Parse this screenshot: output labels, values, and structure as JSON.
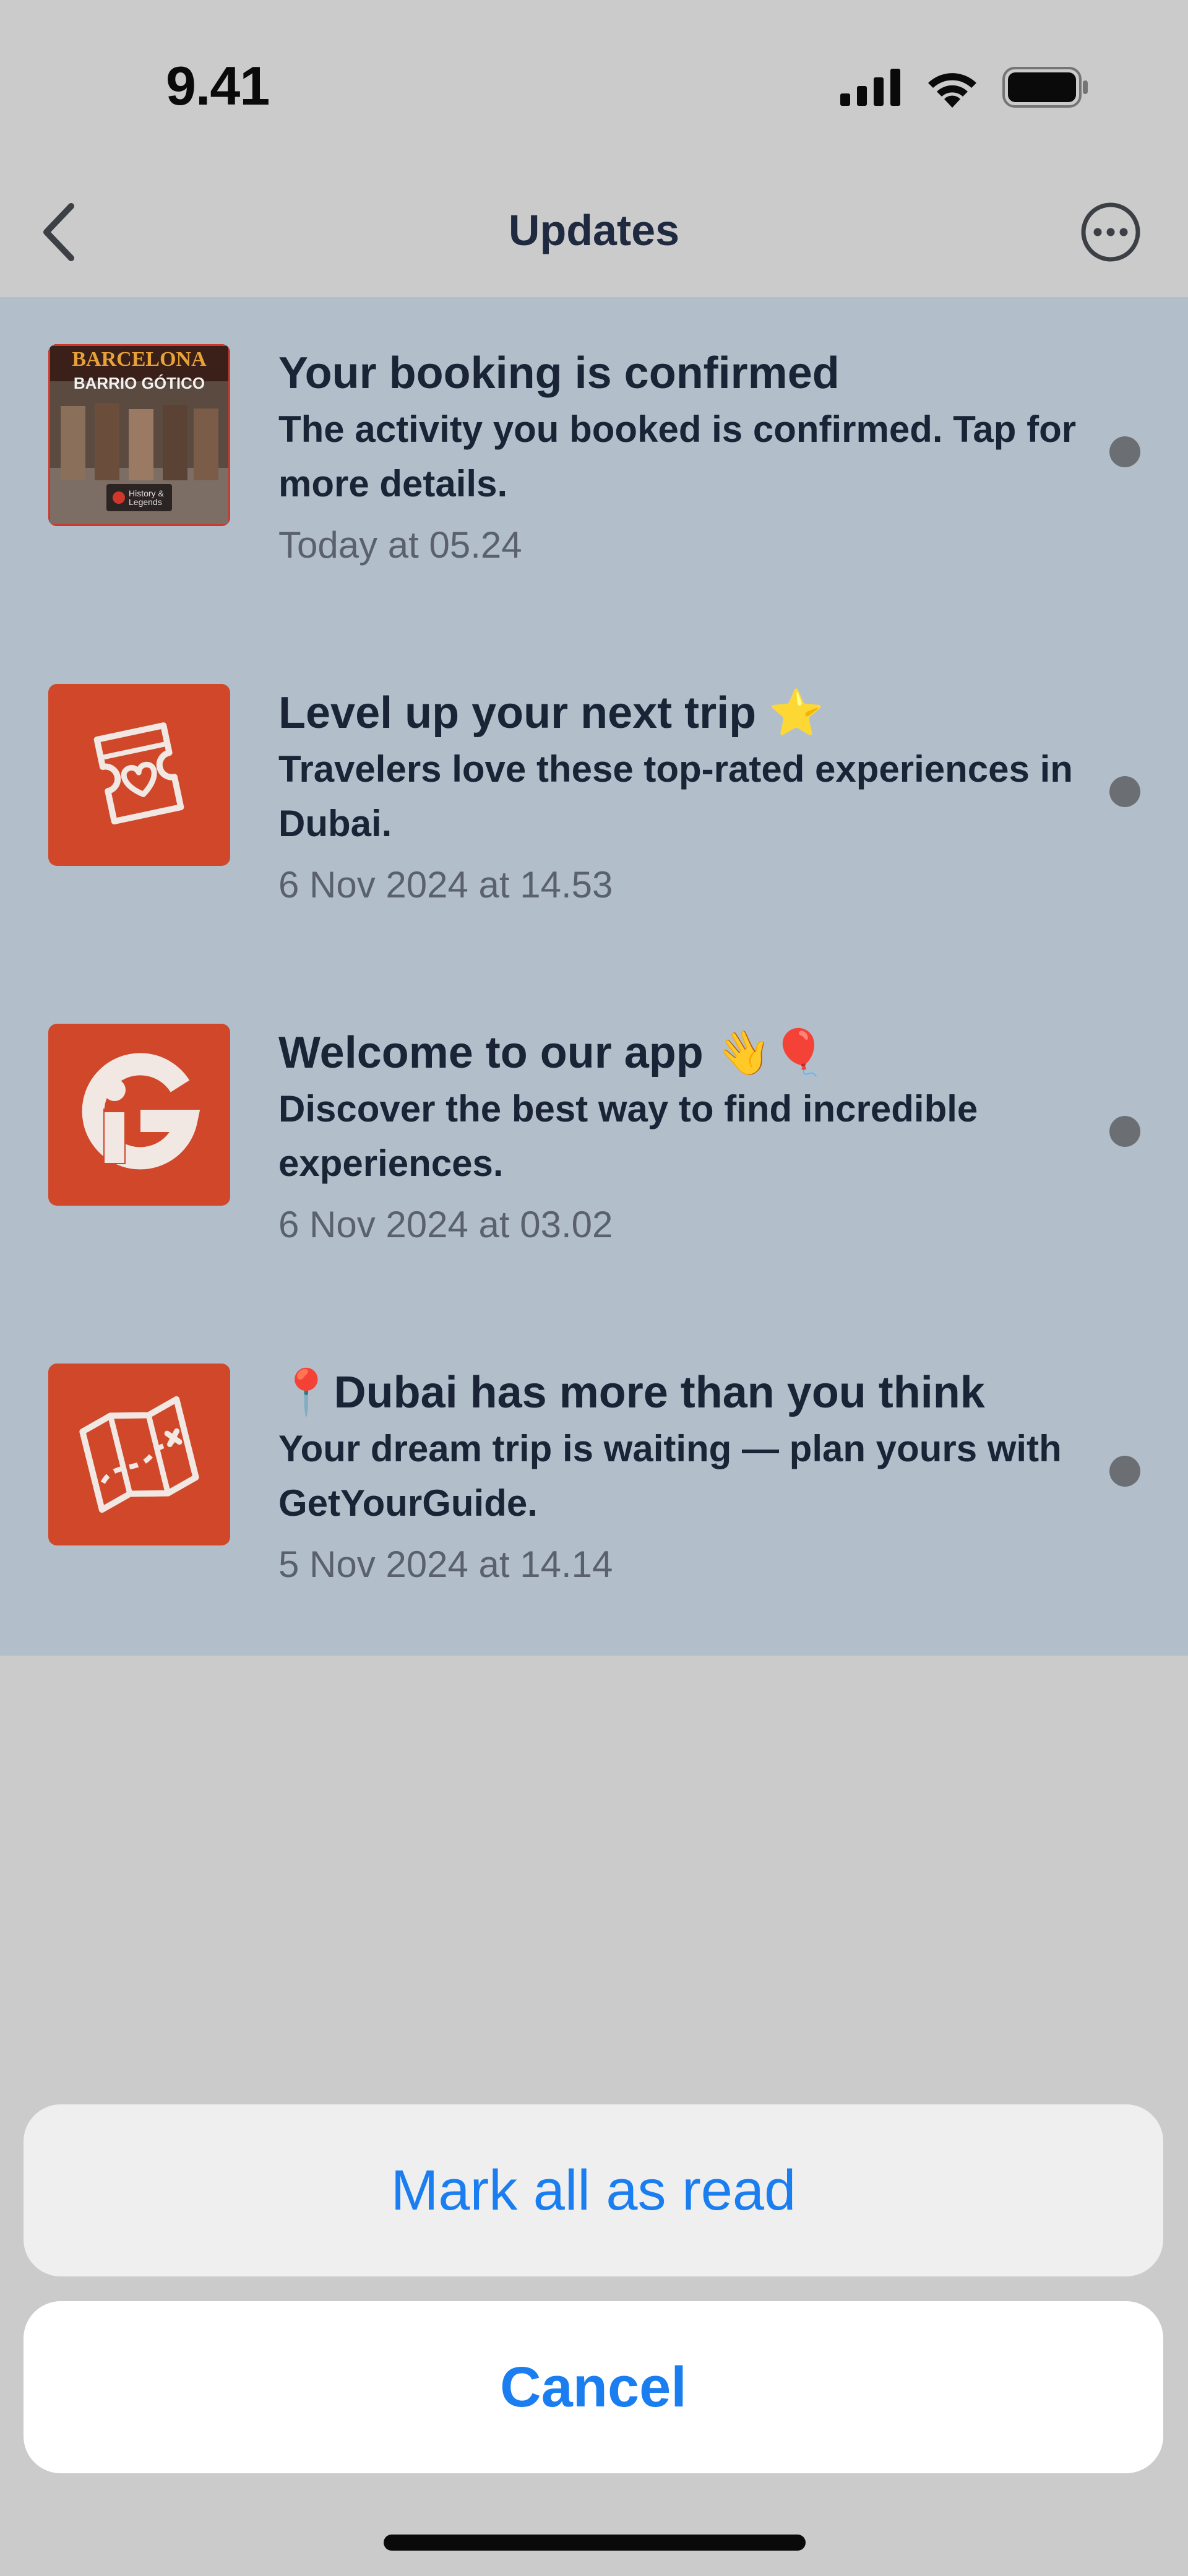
{
  "status_bar": {
    "time": "9.41"
  },
  "nav": {
    "title": "Updates"
  },
  "notifications": [
    {
      "title": "Your booking is confirmed",
      "body": "The activity you booked is confirmed. Tap for more details.",
      "date": "Today at 05.24",
      "thumb_text_1": "BARCELONA",
      "thumb_text_2": "BARRIO GÓTICO",
      "thumb_text_3": "History & Legends"
    },
    {
      "title": "Level up your next trip ⭐",
      "body": "Travelers love these top-rated experiences in Dubai.",
      "date": "6 Nov 2024 at 14.53"
    },
    {
      "title": "Welcome to our app 👋🎈",
      "body": "Discover the best way to find incredible experiences.",
      "date": "6 Nov 2024 at 03.02"
    },
    {
      "title": "📍Dubai has more than you think",
      "body": "Your dream trip is waiting — plan yours with GetYourGuide.",
      "date": "5 Nov 2024 at 14.14"
    }
  ],
  "action_sheet": {
    "mark_all_read": "Mark all as read",
    "cancel": "Cancel"
  },
  "colors": {
    "background": "#cbcbcb",
    "list_background": "#b2bfcb",
    "brand": "#d0472a",
    "action_blue": "#1a7ef0"
  },
  "icons": [
    "signal-icon",
    "wifi-icon",
    "battery-icon",
    "chevron-left-icon",
    "ellipsis-circle-icon",
    "ticket-heart-icon",
    "brand-g-icon",
    "map-icon"
  ]
}
